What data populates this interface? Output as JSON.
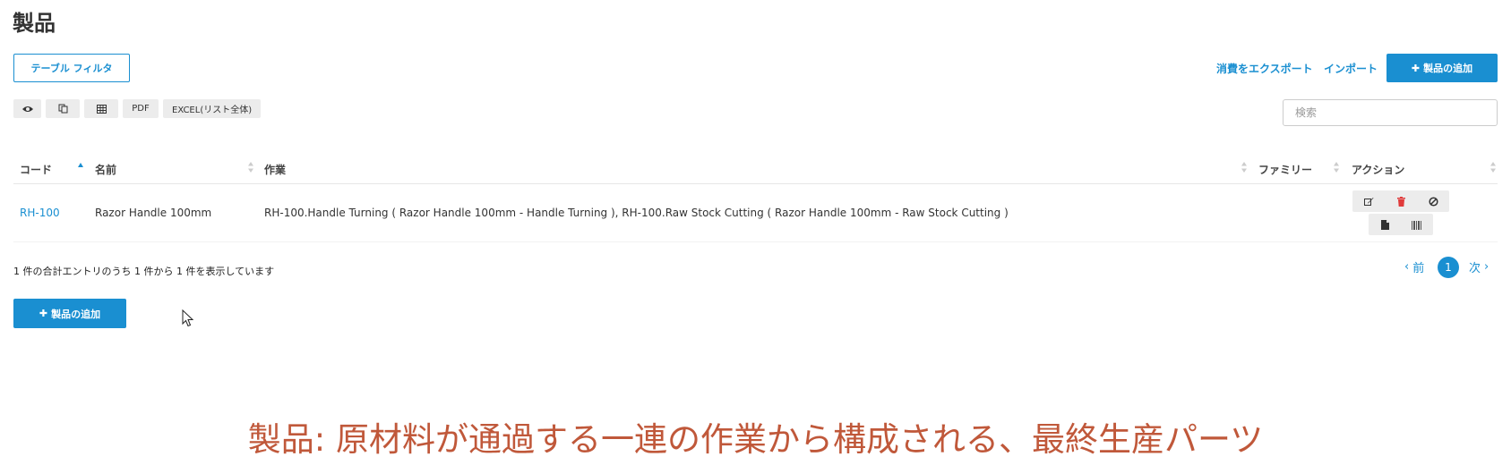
{
  "page": {
    "title": "製品"
  },
  "toolbar": {
    "filter_label": "テーブル フィルタ",
    "export_label": "消費をエクスポート",
    "import_label": "インポート",
    "add_product_label": "製品の追加",
    "pdf_label": "PDF",
    "excel_label": "EXCEL(リスト全体)",
    "icons": [
      "eye-icon",
      "copy-icon",
      "grid-icon"
    ]
  },
  "search": {
    "placeholder": "検索",
    "value": ""
  },
  "table": {
    "headers": {
      "code": "コード",
      "name": "名前",
      "operations": "作業",
      "family": "ファミリー",
      "actions": "アクション"
    },
    "rows": [
      {
        "code": "RH-100",
        "name": "Razor Handle 100mm",
        "operations": "RH-100.Handle Turning ( Razor Handle 100mm - Handle Turning ), RH-100.Raw Stock Cutting ( Razor Handle 100mm - Raw Stock Cutting )",
        "family": "",
        "actions": [
          "edit-icon",
          "delete-icon",
          "disable-icon",
          "document-icon",
          "barcode-icon"
        ]
      }
    ]
  },
  "footer": {
    "summary": "1 件の合計エントリのうち 1 件から 1 件を表示しています",
    "prev_label": "前",
    "next_label": "次",
    "current_page": "1",
    "add_product_label": "製品の追加"
  },
  "caption": "製品: 原材料が通過する一連の作業から構成される、最終生産パーツ",
  "colors": {
    "accent": "#1a8fd1",
    "danger": "#e03a3a",
    "caption": "#c0583a",
    "button_bg": "#ececec"
  }
}
